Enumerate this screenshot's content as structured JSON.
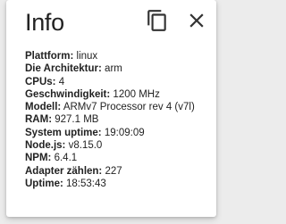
{
  "dialog": {
    "title": "Info",
    "copy_icon": "copy-icon",
    "close_icon": "close-icon"
  },
  "info": [
    {
      "label": "Plattform:",
      "value": "linux"
    },
    {
      "label": "Die Architektur:",
      "value": "arm"
    },
    {
      "label": "CPUs:",
      "value": "4"
    },
    {
      "label": "Geschwindigkeit:",
      "value": "1200 MHz"
    },
    {
      "label": "Modell:",
      "value": "ARMv7 Processor rev 4 (v7l)"
    },
    {
      "label": "RAM:",
      "value": "927.1 MB"
    },
    {
      "label": "System uptime:",
      "value": "19:09:09"
    },
    {
      "label": "Node.js:",
      "value": "v8.15.0"
    },
    {
      "label": "NPM:",
      "value": "6.4.1"
    },
    {
      "label": "Adapter zählen:",
      "value": "227"
    },
    {
      "label": "Uptime:",
      "value": "18:53:43"
    }
  ]
}
